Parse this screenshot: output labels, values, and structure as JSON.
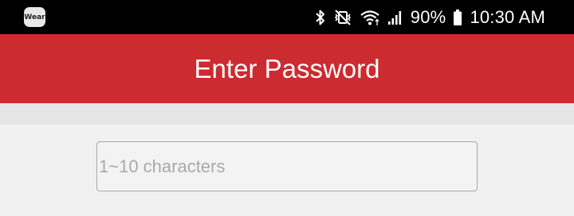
{
  "status_bar": {
    "app_badge": "Wear",
    "icons": [
      "bluetooth-icon",
      "vibrate-mute-icon",
      "wifi-icon",
      "signal-icon",
      "battery-icon"
    ],
    "battery": "90%",
    "time": "10:30 AM"
  },
  "header": {
    "title": "Enter Password"
  },
  "password_field": {
    "value": "",
    "placeholder": "1~10 characters"
  },
  "colors": {
    "header_bg": "#cc2b30",
    "status_bg": "#000000",
    "page_bg": "#f1f1f1"
  }
}
